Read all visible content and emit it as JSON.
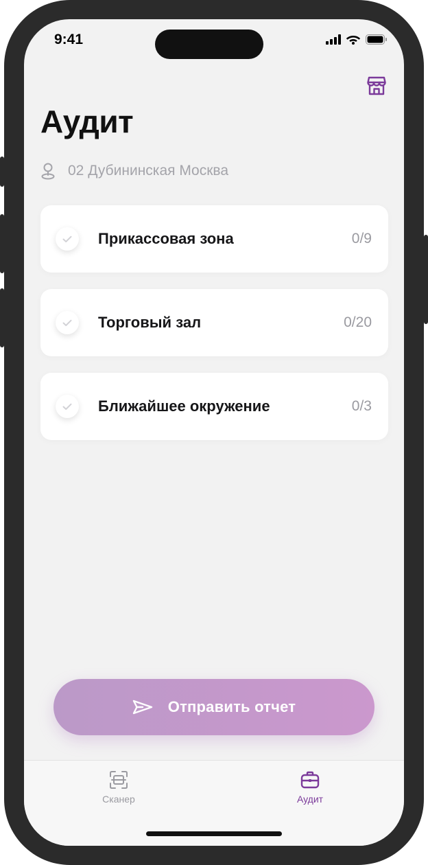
{
  "status_bar": {
    "time": "9:41"
  },
  "header": {
    "title": "Аудит",
    "store_icon": "store-icon"
  },
  "location": {
    "icon": "location-pin-icon",
    "text": "02 Дубининская Москва"
  },
  "sections": [
    {
      "label": "Прикассовая зона",
      "count": "0/9"
    },
    {
      "label": "Торговый зал",
      "count": "0/20"
    },
    {
      "label": "Ближайшее окружение",
      "count": "0/3"
    }
  ],
  "send_button": {
    "label": "Отправить отчет",
    "icon": "send-icon"
  },
  "tab_bar": {
    "tabs": [
      {
        "label": "Сканер",
        "icon": "scanner-icon",
        "active": false
      },
      {
        "label": "Аудит",
        "icon": "briefcase-icon",
        "active": true
      }
    ]
  },
  "colors": {
    "accent": "#7b3a9a",
    "button_gradient_start": "#bb99c8",
    "button_gradient_end": "#cb98cd",
    "background": "#f2f2f2"
  }
}
